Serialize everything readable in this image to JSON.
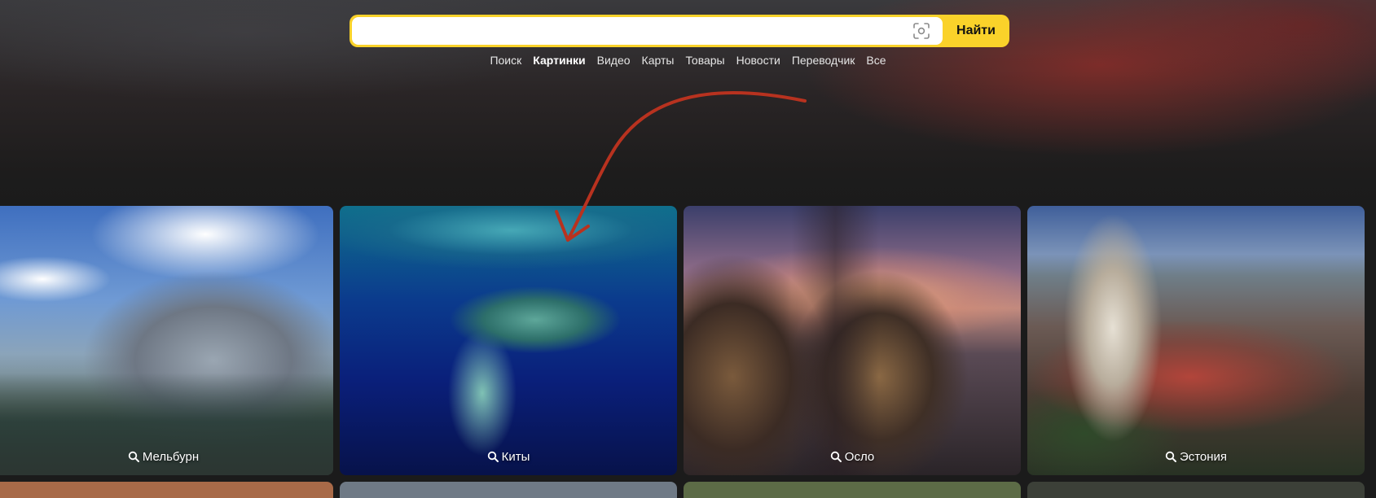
{
  "search": {
    "value": "",
    "placeholder": "",
    "button_label": "Найти",
    "camera_icon": "camera-lens-icon"
  },
  "tabs": [
    {
      "label": "Поиск",
      "active": false
    },
    {
      "label": "Картинки",
      "active": true
    },
    {
      "label": "Видео",
      "active": false
    },
    {
      "label": "Карты",
      "active": false
    },
    {
      "label": "Товары",
      "active": false
    },
    {
      "label": "Новости",
      "active": false
    },
    {
      "label": "Переводчик",
      "active": false
    },
    {
      "label": "Все",
      "active": false
    }
  ],
  "cards": [
    {
      "caption": "Мельбурн",
      "icon": "magnifier-icon"
    },
    {
      "caption": "Киты",
      "icon": "magnifier-icon"
    },
    {
      "caption": "Осло",
      "icon": "magnifier-icon"
    },
    {
      "caption": "Эстония",
      "icon": "magnifier-icon"
    }
  ],
  "colors": {
    "search_accent": "#fad22a",
    "annotation_arrow": "#b8321f",
    "page_background": "#1b1b1b"
  }
}
